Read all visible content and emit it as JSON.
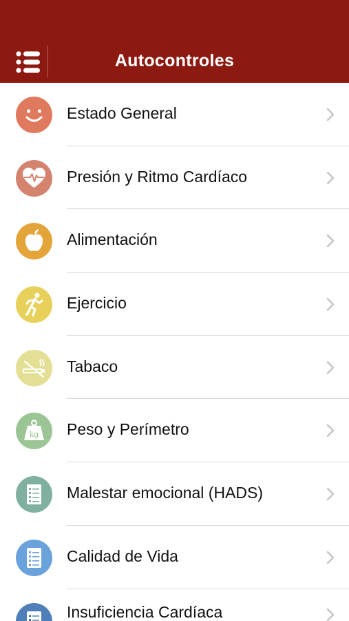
{
  "navbar": {
    "title": "Autocontroles",
    "menu_icon": "list-menu-icon",
    "background_color": "#8c1a10"
  },
  "items": [
    {
      "label": "Estado General",
      "icon": "smile-face-icon",
      "color": "#e07a5f"
    },
    {
      "label": "Presión y Ritmo Cardíaco",
      "icon": "heart-pulse-icon",
      "color": "#d4836f"
    },
    {
      "label": "Alimentación",
      "icon": "apple-icon",
      "color": "#e3a53a"
    },
    {
      "label": "Ejercicio",
      "icon": "running-person-icon",
      "color": "#e8d15a"
    },
    {
      "label": "Tabaco",
      "icon": "no-smoking-icon",
      "color": "#e3df94"
    },
    {
      "label": "Peso y Perímetro",
      "icon": "weight-kg-icon",
      "color": "#9cc596",
      "weight_text": "kg"
    },
    {
      "label": "Malestar emocional (HADS)",
      "icon": "checklist-icon",
      "color": "#7fb0a0"
    },
    {
      "label": "Calidad de Vida",
      "icon": "checklist-icon",
      "color": "#6aa3dc"
    },
    {
      "label": "Insuficiencia Cardíaca",
      "icon": "checklist-icon",
      "color": "#4f7fb8"
    }
  ]
}
